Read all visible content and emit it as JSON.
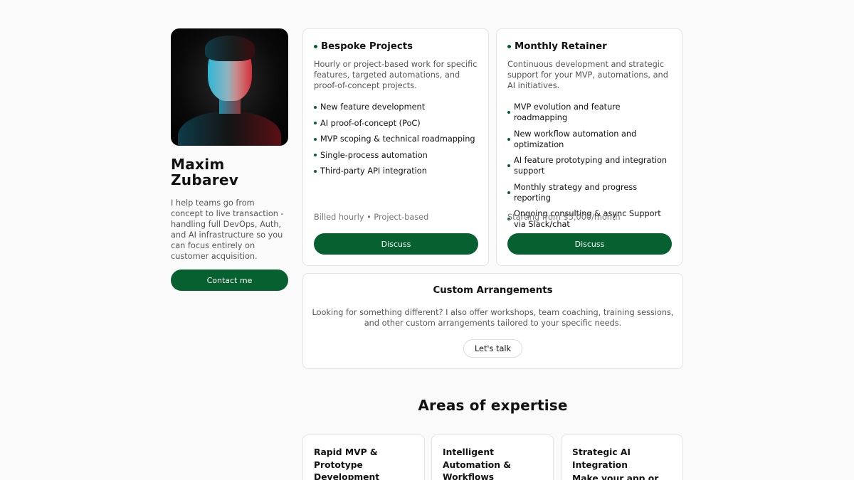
{
  "profile": {
    "name": "Maxim Zubarev",
    "bio": "I help teams go from concept to live transaction - handling full DevOps, Auth, and AI infrastructure so you can focus entirely on customer acquisition.",
    "contact_label": "Contact me"
  },
  "plans": [
    {
      "title": "Bespoke Projects",
      "description": "Hourly or project-based work for specific features, targeted automations, and proof-of-concept projects.",
      "features": [
        "New feature development",
        "AI proof-of-concept (PoC)",
        "MVP scoping & technical roadmapping",
        "Single-process automation",
        "Third-party API integration"
      ],
      "meta": "Billed hourly • Project-based",
      "button": "Discuss"
    },
    {
      "title": "Monthly Retainer",
      "description": "Continuous development and strategic support for your MVP, automations, and AI initiatives.",
      "features": [
        "MVP evolution and feature roadmapping",
        "New workflow automation and optimization",
        "AI feature prototyping and integration support",
        "Monthly strategy and progress reporting",
        "Ongoing consulting & async Support via Slack/chat"
      ],
      "meta": "Starting from $5,000/month",
      "button": "Discuss"
    }
  ],
  "custom": {
    "title": "Custom Arrangements",
    "description": "Looking for something different? I also offer workshops, team coaching, training sessions, and other custom arrangements tailored to your specific needs.",
    "button": "Let's talk"
  },
  "expertise": {
    "title": "Areas of expertise",
    "cards": [
      {
        "title": "Rapid MVP & Prototype Development"
      },
      {
        "title": "Intelligent Automation & Workflows"
      },
      {
        "title": "Strategic AI Integration",
        "subtitle": "Make your app or"
      }
    ]
  },
  "colors": {
    "accent": "#06602f",
    "background": "#fafafa",
    "card": "#ffffff",
    "muted_text": "#555555"
  }
}
